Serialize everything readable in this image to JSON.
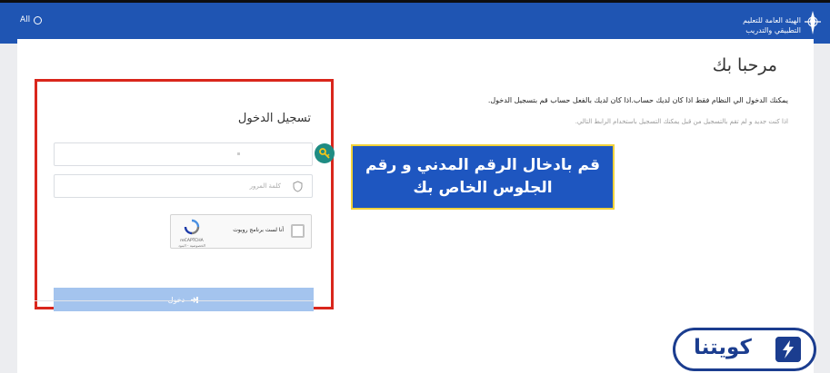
{
  "header": {
    "language_label": "All",
    "org_name_line1": "الهيئة العامة للتعليم",
    "org_name_line2": "التطبيقي والتدريب"
  },
  "welcome": {
    "title": "مرحبا بك",
    "description_primary": "يمكنك الدخول الي النظام فقط اذا كان لديك حساب.اذا كان لديك بالفعل حساب قم بتسجيل الدخول.",
    "description_secondary": "اذا كنت جديد و لم تقم بالتسجيل من قبل يمكنك التسجيل باستخدام الرابط التالي."
  },
  "login": {
    "title": "تسجيل الدخول",
    "id_placeholder": "",
    "password_placeholder": "كلمة المرور",
    "captcha_label": "أنا لست برنامج روبوت",
    "captcha_brand": "reCAPTCHA",
    "captcha_privacy": "الخصوصية - البنود",
    "submit_label": "دخول"
  },
  "callout": {
    "line1": "قم بادخال الرقم المدني و رقم",
    "line2": "الجلوس الخاص بك"
  },
  "watermark": {
    "brand_name": "كويتنا"
  },
  "colors": {
    "header_blue": "#1f55b3",
    "highlight_red": "#d9261c",
    "callout_blue": "#1e56c0",
    "callout_border": "#f1d23a",
    "button_disabled": "#a4c4ee",
    "brand_navy": "#1b3d8f",
    "key_badge": "#1f8c83"
  },
  "icons": {
    "language": "globe-icon",
    "org_logo": "org-logo-icon",
    "key": "key-icon",
    "password": "shield-icon",
    "captcha": "recaptcha-icon",
    "submit": "login-arrow-icon",
    "brand": "brand-logo-icon"
  }
}
